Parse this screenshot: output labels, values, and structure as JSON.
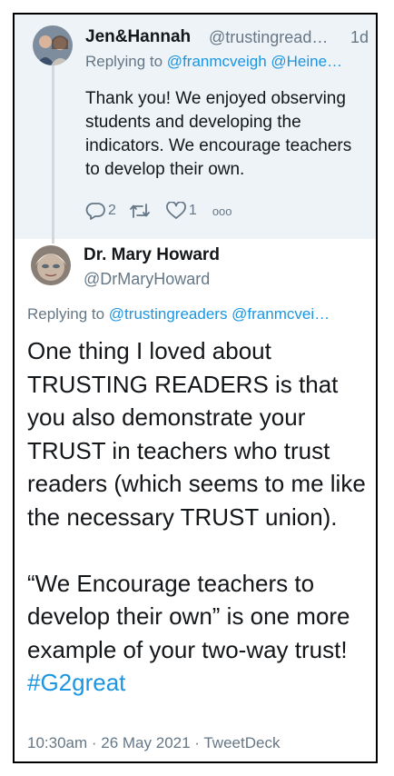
{
  "reply_tweet": {
    "author_name": "Jen&Hannah",
    "author_handle": "@trustingread…",
    "time": "1d",
    "replying_prefix": "Replying to",
    "replying_handles": "@franmcveigh @Heine…",
    "text": "Thank you! We enjoyed observing students and developing the indicators. We encourage teachers to develop their own.",
    "reply_count": "2",
    "like_count": "1",
    "more_label": "ooo"
  },
  "main_tweet": {
    "author_name": "Dr. Mary Howard",
    "author_handle": "@DrMaryHoward",
    "replying_prefix": "Replying to",
    "replying_handles": "@trustingreaders @franmcvei…",
    "text_p1": "One thing I loved about TRUSTING READERS is that you also demonstrate your TRUST in teachers who trust readers (which seems to me like the necessary TRUST union).",
    "text_p2": "“We Encourage teachers to develop their own” is one more example of your two-way trust!",
    "hashtag": "#G2great",
    "timestamp": "10:30am · 26 May 2021 · TweetDeck"
  },
  "colors": {
    "link": "#1b95e0",
    "muted": "#657786",
    "reply_bg": "#eef3f8",
    "text": "#14171a"
  },
  "icons": [
    "reply-icon",
    "retweet-icon",
    "like-icon",
    "more-icon"
  ]
}
